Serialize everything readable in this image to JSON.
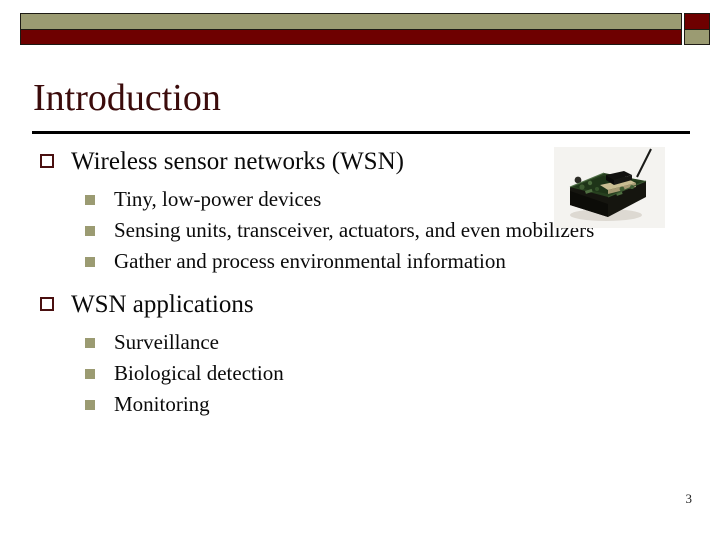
{
  "slide": {
    "title": "Introduction",
    "page_number": "3",
    "colors": {
      "khaki": "#9b9b72",
      "maroon": "#6e0000",
      "title_text": "#3b0b0b",
      "marker_outline": "#4a1010",
      "body_text": "#0a0a0a",
      "rule": "#000000"
    },
    "header": {
      "bar_top_color": "#9b9b72",
      "bar_bottom_color": "#6e0000",
      "right_block_top_color": "#6e0000",
      "right_block_bottom_color": "#9b9b72"
    },
    "content": [
      {
        "level": 1,
        "marker": "hollow-square-bullet",
        "text": "Wireless sensor networks (WSN)"
      },
      {
        "level": 2,
        "marker": "filled-square-bullet",
        "text": "Tiny, low-power devices"
      },
      {
        "level": 2,
        "marker": "filled-square-bullet",
        "text": "Sensing units, transceiver, actuators, and even mobilizers"
      },
      {
        "level": 2,
        "marker": "filled-square-bullet",
        "text": "Gather and process environmental information"
      },
      {
        "level": 1,
        "marker": "hollow-square-bullet",
        "text": "WSN applications"
      },
      {
        "level": 2,
        "marker": "filled-square-bullet",
        "text": "Surveillance"
      },
      {
        "level": 2,
        "marker": "filled-square-bullet",
        "text": "Biological detection"
      },
      {
        "level": 2,
        "marker": "filled-square-bullet",
        "text": "Monitoring"
      }
    ],
    "image": {
      "name": "wireless-sensor-mote-photo",
      "alt": "Photograph of a small wireless sensor mote with circuit board and antenna"
    }
  }
}
